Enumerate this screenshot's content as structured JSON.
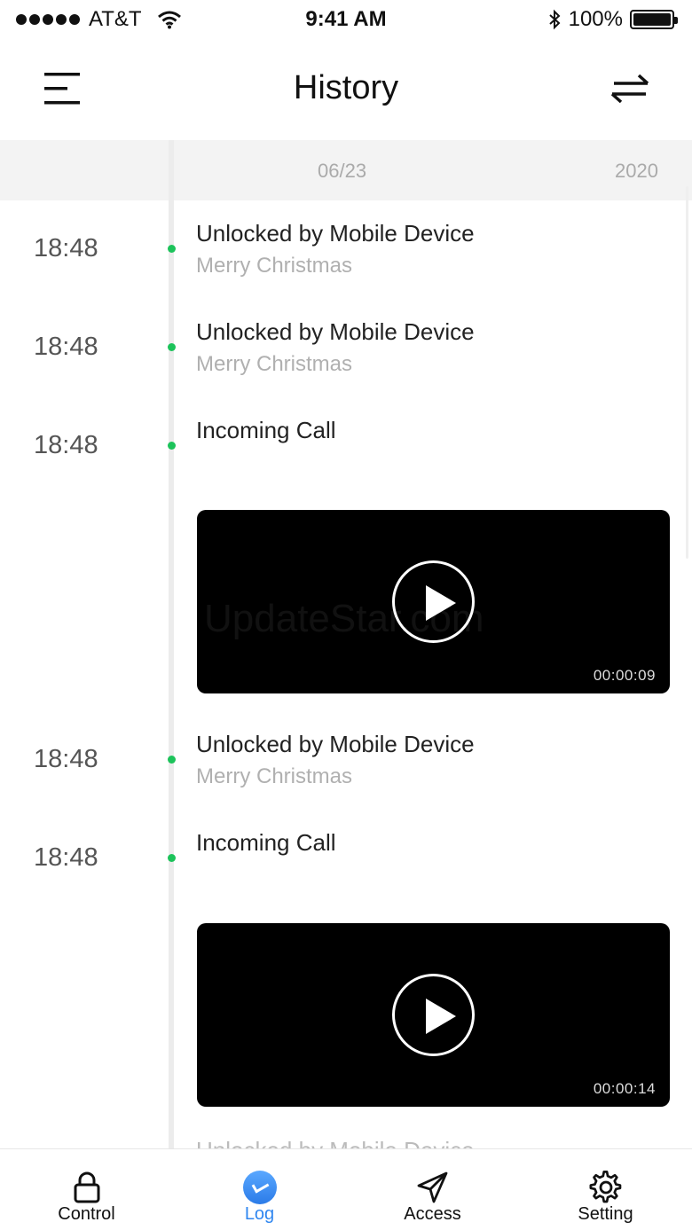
{
  "status_bar": {
    "carrier": "AT&T",
    "time": "9:41 AM",
    "battery": "100%"
  },
  "header": {
    "title": "History",
    "menu_icon": "menu-icon",
    "swap_icon": "swap-arrows-icon"
  },
  "date_header": {
    "date": "06/23",
    "year": "2020"
  },
  "entries": [
    {
      "time": "18:48",
      "title": "Unlocked by Mobile Device",
      "subtitle": "Merry Christmas"
    },
    {
      "time": "18:48",
      "title": "Unlocked by Mobile Device",
      "subtitle": "Merry Christmas"
    },
    {
      "time": "18:48",
      "title": "Incoming Call",
      "video_duration": "00:00:09"
    },
    {
      "time": "18:48",
      "title": "Unlocked by Mobile Device",
      "subtitle": "Merry Christmas"
    },
    {
      "time": "18:48",
      "title": "Incoming Call",
      "video_duration": "00:00:14"
    }
  ],
  "partial_entry_title": "Unlocked by Mobile Device",
  "watermark": "UpdateStar.com",
  "tabs": [
    {
      "label": "Control",
      "icon": "lock-icon",
      "active": false
    },
    {
      "label": "Log",
      "icon": "clock-icon",
      "active": true
    },
    {
      "label": "Access",
      "icon": "paper-plane-icon",
      "active": false
    },
    {
      "label": "Setting",
      "icon": "gear-icon",
      "active": false
    }
  ],
  "colors": {
    "accent": "#2f86f0",
    "dot": "#1cc35a"
  }
}
